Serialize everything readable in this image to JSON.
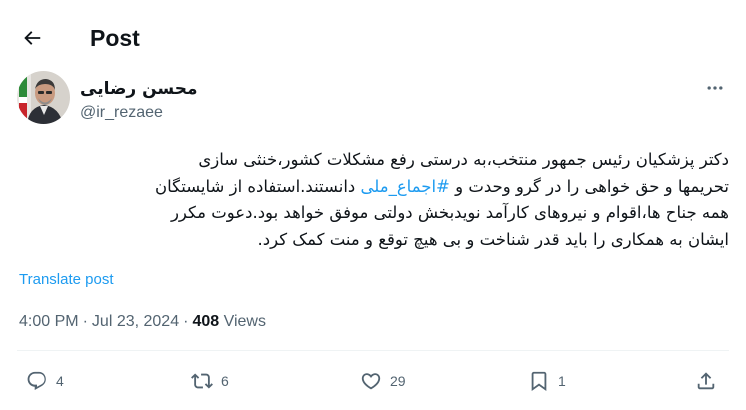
{
  "header": {
    "back_icon": "arrow-left-icon",
    "title": "Post"
  },
  "author": {
    "name": "محسن رضایی",
    "handle": "@ir_rezaee",
    "avatar_icon": "profile-photo"
  },
  "tweet": {
    "lines": [
      "دکتر پزشکیان رئیس جمهور منتخب،به درستی رفع مشکلات کشور،خنثی سازی",
      "تحریمها و حق خواهی را در گرو وحدت و",
      "همه جناح ها،اقوام و نیروهای کارآمد نویدبخش دولتی موفق خواهد بود.دعوت مکرر",
      "ایشان به همکاری را باید قدر شناخت و بی هیچ توقع و منت کمک کرد."
    ],
    "hashtag": "#اجماع_ملی",
    "line2_tail": "دانستند.استفاده از شایستگان"
  },
  "translate_label": "Translate post",
  "meta": {
    "time": "4:00 PM",
    "separator": "·",
    "date": "Jul 23, 2024",
    "views_count": "408",
    "views_label": "Views"
  },
  "actions": {
    "replies": "4",
    "reposts": "6",
    "likes": "29",
    "bookmarks": "1"
  },
  "colors": {
    "accent": "#1d9bf0",
    "text": "#0f1419",
    "secondary": "#536471",
    "divider": "#eff3f4"
  }
}
